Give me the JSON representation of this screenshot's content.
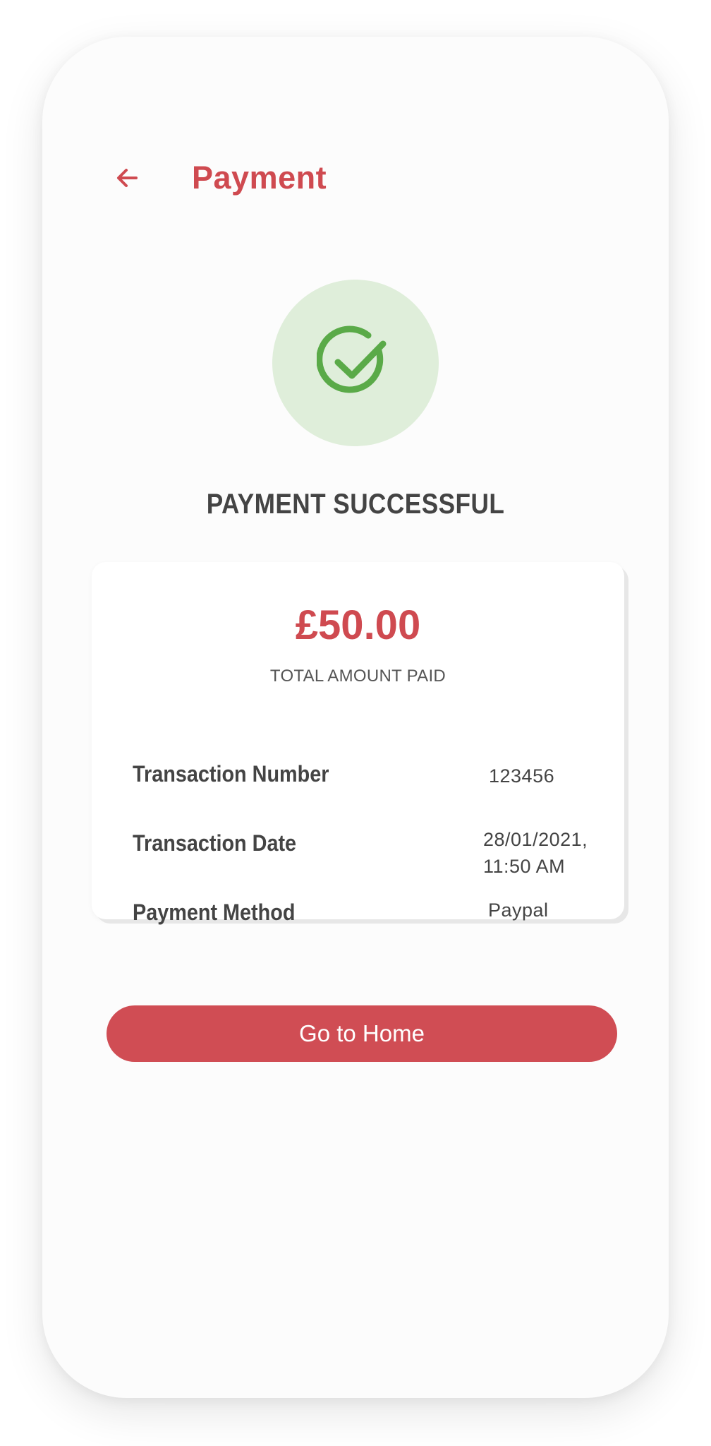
{
  "header": {
    "title": "Payment",
    "back_icon": "arrow-left-icon"
  },
  "status": {
    "icon": "check-circle-icon",
    "title": "PAYMENT SUCCESSFUL",
    "icon_color": "#5aaa48",
    "icon_background": "#dfeeda"
  },
  "summary": {
    "amount": "£50.00",
    "amount_label": "TOTAL AMOUNT PAID",
    "rows": [
      {
        "label": "Transaction Number",
        "value": "123456"
      },
      {
        "label": "Transaction Date",
        "value_line1": "28/01/2021,",
        "value_line2": "11:50 AM"
      },
      {
        "label": "Payment Method",
        "value": "Paypal"
      }
    ]
  },
  "actions": {
    "home_label": "Go to Home"
  },
  "colors": {
    "accent": "#cf4a50",
    "text": "#444444"
  }
}
